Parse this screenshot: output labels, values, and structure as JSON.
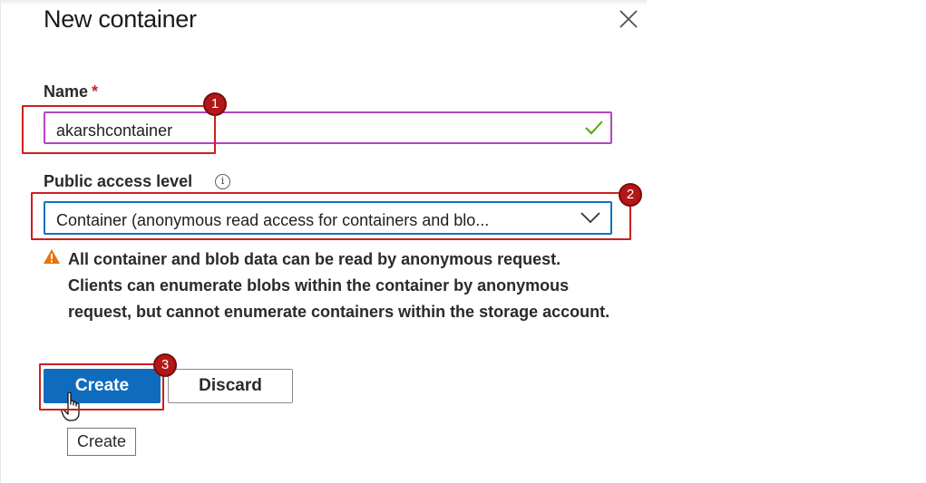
{
  "dialog": {
    "title": "New container",
    "close_icon": "close-icon"
  },
  "name_field": {
    "label": "Name",
    "required_mark": "*",
    "value": "akarshcontainer",
    "valid_icon": "checkmark-icon"
  },
  "access_field": {
    "label": "Public access level",
    "info_icon": "info-icon",
    "info_glyph": "i",
    "selected": "Container (anonymous read access for containers and blo..."
  },
  "warning": {
    "icon": "warning-icon",
    "text": "All container and blob data can be read by anonymous request. Clients can enumerate blobs within the container by anonymous request, but cannot enumerate containers within the storage account."
  },
  "buttons": {
    "create": "Create",
    "discard": "Discard"
  },
  "tooltip": {
    "text": "Create"
  },
  "callouts": {
    "one": "1",
    "two": "2",
    "three": "3"
  },
  "colors": {
    "primary": "#0f6cbd",
    "focus_border": "#b146c2",
    "select_border": "#1070c4",
    "valid": "#57a300",
    "warning": "#e8730c",
    "callout": "#b31717"
  }
}
